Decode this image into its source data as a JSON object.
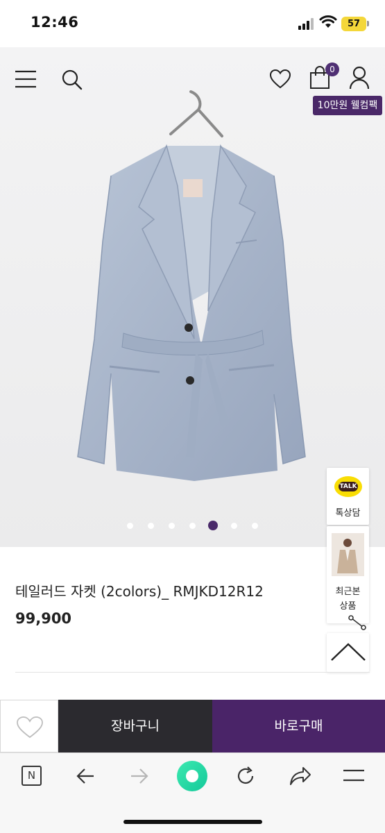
{
  "status_bar": {
    "time": "12:46",
    "battery": "57"
  },
  "header": {
    "menu_icon": "hamburger-icon",
    "search_icon": "search-icon",
    "wishlist_icon": "heart-icon",
    "cart_icon": "shopping-bag-icon",
    "cart_count": "0",
    "account_icon": "user-icon",
    "promo_badge": "10만원 웰컴팩"
  },
  "gallery": {
    "total_slides": 7,
    "active_slide": 5
  },
  "side_widgets": {
    "talk_badge": "TALK",
    "talk_label": "톡상담",
    "recent_label_line1": "최근본",
    "recent_label_line2": "상품"
  },
  "product": {
    "name": "테일러드 자켓 (2colors)_ RMJKD12R12",
    "price": "99,900"
  },
  "purchase_bar": {
    "cart_label": "장바구니",
    "buy_label": "바로구매"
  },
  "browser_toolbar": {
    "home_label": "N"
  },
  "colors": {
    "brand_purple": "#4a2468",
    "cart_button": "#2b2a2f",
    "jacket_blue": "#a9b6cb"
  }
}
